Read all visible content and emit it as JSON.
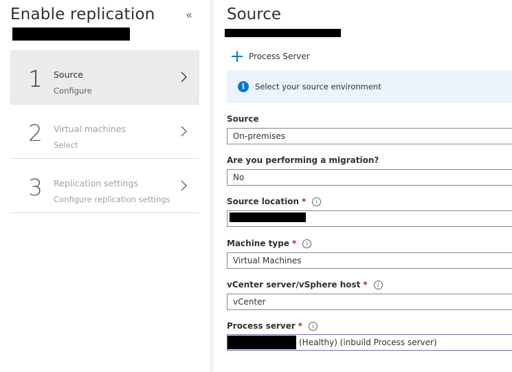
{
  "left_blade": {
    "title": "Enable replication",
    "collapse_glyph": "«",
    "steps": [
      {
        "number": "1",
        "title": "Source",
        "subtitle": "Configure",
        "active": true
      },
      {
        "number": "2",
        "title": "Virtual machines",
        "subtitle": "Select",
        "active": false
      },
      {
        "number": "3",
        "title": "Replication settings",
        "subtitle": "Configure replication settings",
        "active": false
      }
    ]
  },
  "right_blade": {
    "title": "Source",
    "command": {
      "label": "Process Server",
      "icon": "plus-icon"
    },
    "info": {
      "icon": "info-icon",
      "text": "Select your source environment"
    },
    "fields": {
      "source": {
        "label": "Source",
        "value": "On-premises"
      },
      "migration": {
        "label": "Are you performing a migration?",
        "value": "No"
      },
      "source_location": {
        "label": "Source location",
        "required": true,
        "value": ""
      },
      "machine_type": {
        "label": "Machine type",
        "required": true,
        "value": "Virtual Machines"
      },
      "vcenter": {
        "label": "vCenter server/vSphere host",
        "required": true,
        "value": "vCenter"
      },
      "process_server": {
        "label": "Process server",
        "required": true,
        "value": "(Healthy) (inbuild Process server)"
      }
    }
  },
  "colors": {
    "accent": "#0078d4",
    "required": "#a4262c",
    "info_bg": "#ebf3fc",
    "active_step_bg": "#edebe9",
    "focus_border": "#8764b8"
  }
}
